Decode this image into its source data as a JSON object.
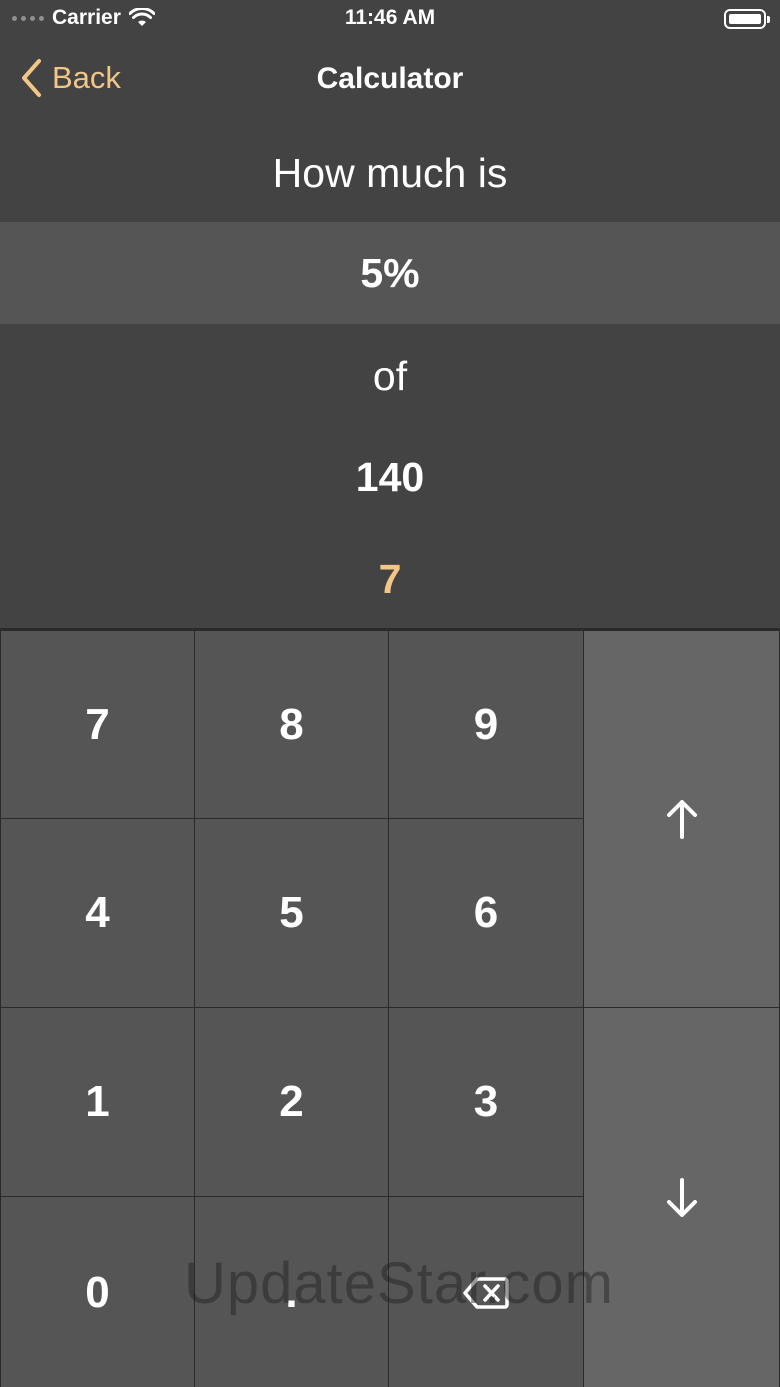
{
  "status_bar": {
    "carrier": "Carrier",
    "time": "11:46 AM"
  },
  "nav": {
    "back_label": "Back",
    "title": "Calculator"
  },
  "calculator": {
    "question": "How much is",
    "percent": "5%",
    "of_label": "of",
    "value": "140",
    "result": "7"
  },
  "keypad": {
    "keys": [
      "7",
      "8",
      "9",
      "4",
      "5",
      "6",
      "1",
      "2",
      "3",
      "0",
      "."
    ],
    "up_icon": "arrow-up-icon",
    "down_icon": "arrow-down-icon",
    "delete_icon": "backspace-icon"
  },
  "colors": {
    "accent": "#f2c686",
    "background": "#434343",
    "highlight_row": "#555555",
    "key": "#555555",
    "arrow_key": "#666666"
  },
  "watermark": "UpdateStar.com"
}
